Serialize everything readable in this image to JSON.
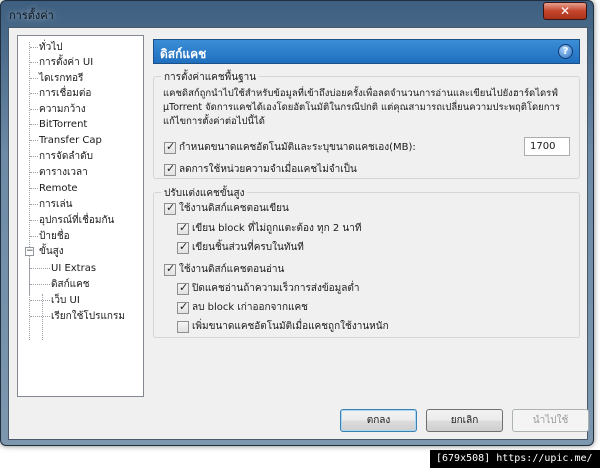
{
  "window": {
    "title": "การตั้งค่า",
    "close_glyph": "✕"
  },
  "tree": {
    "items": [
      "ทั่วไป",
      "การตั้งค่า UI",
      "ไดเรกทอรี",
      "การเชื่อมต่อ",
      "ความกว้าง",
      "BitTorrent",
      "Transfer Cap",
      "การจัดลำดับ",
      "ตารางเวลา",
      "Remote",
      "การเล่น",
      "อุปกรณ์ที่เชื่อมกัน",
      "ป้ายชื่อ",
      "ขั้นสูง",
      "UI Extras",
      "ดิสก์แคช",
      "เว็บ UI",
      "เรียกใช้โปรแกรม"
    ],
    "expander_glyph": "−"
  },
  "panel": {
    "title": "ดิสก์แคช",
    "help_glyph": "?"
  },
  "basic": {
    "legend": "การตั้งค่าแคชพื้นฐาน",
    "description": [
      "แคชดิสก์ถูกนำไปใช้สำหรับข้อมูลที่เข้าถึงบ่อยครั้งเพื่อลดจำนวนการอ่านและเขียนไปยังฮาร์ดไดรฟ์",
      "µTorrent จัดการแคชได้เองโดยอัตโนมัติในกรณีปกติ แต่คุณสามารถเปลี่ยนความประพฤติโดยการ",
      "แก้ไขการตั้งค่าต่อไปนี้ได้"
    ],
    "override_label": "กำหนดขนาดแคชอัตโนมัติและระบุขนาดแคชเอง(MB):",
    "override_checked": true,
    "cache_size_value": "1700",
    "reduce_label": "ลดการใช้หน่วยความจำเมื่อแคชไม่จำเป็น",
    "reduce_checked": true
  },
  "advanced": {
    "legend": "ปรับแต่งแคชขั้นสูง",
    "write_cache_label": "ใช้งานดิสก์แคชตอนเขียน",
    "write_cache_checked": true,
    "write_untouched_label": "เขียน block ที่ไม่ถูกแตะต้อง ทุก 2 นาที",
    "write_untouched_checked": true,
    "write_finished_label": "เขียนชิ้นส่วนที่ครบในทันที",
    "write_finished_checked": true,
    "read_cache_label": "ใช้งานดิสก์แคชตอนอ่าน",
    "read_cache_checked": true,
    "turn_off_read_label": "ปิดแคชอ่านถ้าความเร็วการส่งข้อมูลต่ำ",
    "turn_off_read_checked": true,
    "remove_old_label": "ลบ block เก่าออกจากแคช",
    "remove_old_checked": true,
    "increase_label": "เพิ่มขนาดแคชอัตโนมัติเมื่อแคชถูกใช้งานหนัก",
    "increase_checked": false
  },
  "buttons": {
    "ok": "ตกลง",
    "cancel": "ยกเลิก",
    "apply": "นำไปใช้"
  },
  "watermark": "[679x508] https://upic.me/"
}
